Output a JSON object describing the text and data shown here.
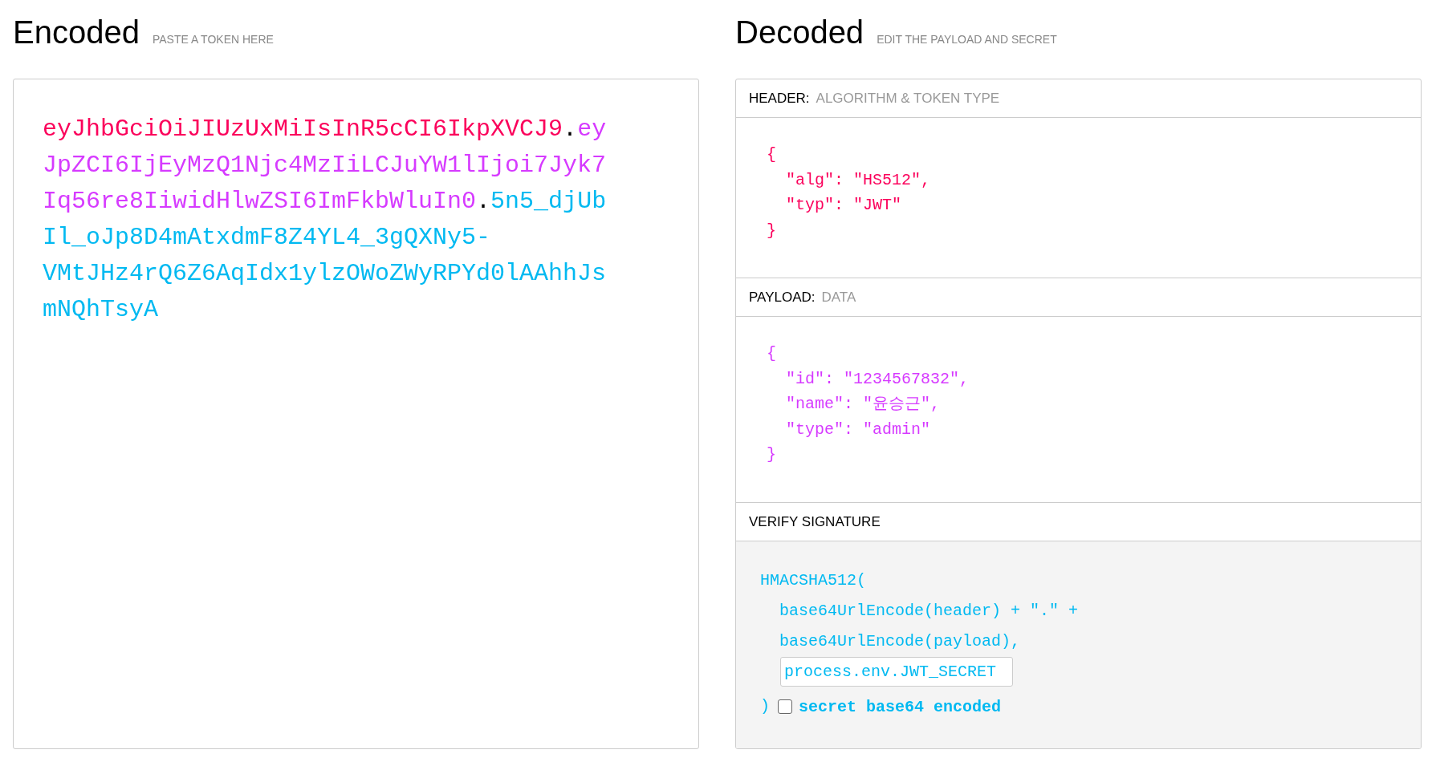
{
  "encoded": {
    "title": "Encoded",
    "hint": "PASTE A TOKEN HERE",
    "token_lines": [
      [
        {
          "kind": "header",
          "text": "eyJhbGciOiJIUzUxMiIsInR5cCI6IkpXVCJ9"
        },
        {
          "kind": "dot",
          "text": "."
        },
        {
          "kind": "payload",
          "text": "ey"
        }
      ],
      [
        {
          "kind": "payload",
          "text": "JpZCI6IjEyMzQ1Njc4MzIiLCJuYW1lIjoi7Jyk7"
        }
      ],
      [
        {
          "kind": "payload",
          "text": "Iq56re8IiwidHlwZSI6ImFkbWluIn0"
        },
        {
          "kind": "dot",
          "text": "."
        },
        {
          "kind": "signature",
          "text": "5n5_djUb"
        }
      ],
      [
        {
          "kind": "signature",
          "text": "Il_oJp8D4mAtxdmF8Z4YL4_3gQXNy5-"
        }
      ],
      [
        {
          "kind": "signature",
          "text": "VMtJHz4rQ6Z6AqIdx1ylzOWoZWyRPYd0lAAhhJs"
        }
      ],
      [
        {
          "kind": "signature",
          "text": "mNQhTsyA"
        }
      ]
    ]
  },
  "decoded": {
    "title": "Decoded",
    "hint": "EDIT THE PAYLOAD AND SECRET",
    "header": {
      "label": "HEADER:",
      "sublabel": "ALGORITHM & TOKEN TYPE",
      "lines": [
        "{",
        "  \"alg\": \"HS512\",",
        "  \"typ\": \"JWT\"",
        "}"
      ]
    },
    "payload": {
      "label": "PAYLOAD:",
      "sublabel": "DATA",
      "lines": [
        "{",
        "  \"id\": \"1234567832\",",
        "  \"name\": \"윤승근\",",
        "  \"type\": \"admin\"",
        "}"
      ]
    },
    "verify": {
      "label": "VERIFY SIGNATURE",
      "lines": [
        "HMACSHA512(",
        "  base64UrlEncode(header) + \".\" +",
        "  base64UrlEncode(payload),"
      ],
      "secret": "process.env.JWT_SECRET",
      "close": ")",
      "base64_checkbox": {
        "label": "secret base64 encoded",
        "checked": false
      }
    }
  }
}
